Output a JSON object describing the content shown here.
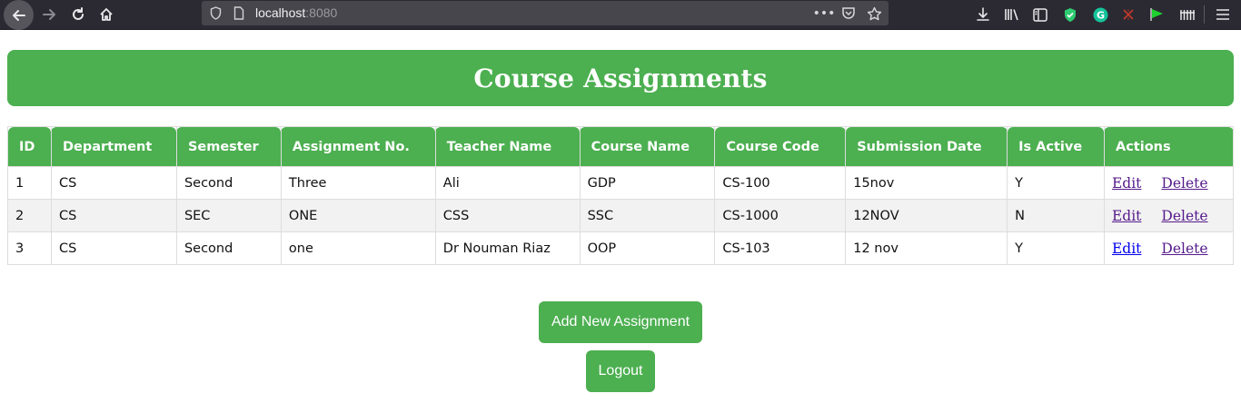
{
  "browser": {
    "url_host": "localhost",
    "url_port": ":8080",
    "icons": {
      "back": "back-arrow-icon",
      "forward": "forward-arrow-icon",
      "reload": "reload-icon",
      "home": "home-icon"
    }
  },
  "page": {
    "title": "Course Assignments"
  },
  "table": {
    "headers": [
      "ID",
      "Department",
      "Semester",
      "Assignment No.",
      "Teacher Name",
      "Course Name",
      "Course Code",
      "Submission Date",
      "Is Active",
      "Actions"
    ],
    "rows": [
      {
        "id": "1",
        "department": "CS",
        "semester": "Second",
        "assignment_no": "Three",
        "teacher": "Ali",
        "course_name": "GDP",
        "course_code": "CS-100",
        "submission_date": "15nov",
        "is_active": "Y",
        "edit": "Edit",
        "delete": "Delete"
      },
      {
        "id": "2",
        "department": "CS",
        "semester": "SEC",
        "assignment_no": "ONE",
        "teacher": "CSS",
        "course_name": "SSC",
        "course_code": "CS-1000",
        "submission_date": "12NOV",
        "is_active": "N",
        "edit": "Edit",
        "delete": "Delete"
      },
      {
        "id": "3",
        "department": "CS",
        "semester": "Second",
        "assignment_no": "one",
        "teacher": "Dr Nouman Riaz",
        "course_name": "OOP",
        "course_code": "CS-103",
        "submission_date": "12 nov",
        "is_active": "Y",
        "edit": "Edit",
        "delete": "Delete"
      }
    ]
  },
  "buttons": {
    "add": "Add New Assignment",
    "logout": "Logout"
  },
  "colors": {
    "accent": "#4caf50",
    "visited_link": "#551a8b",
    "link": "#0000ee"
  }
}
